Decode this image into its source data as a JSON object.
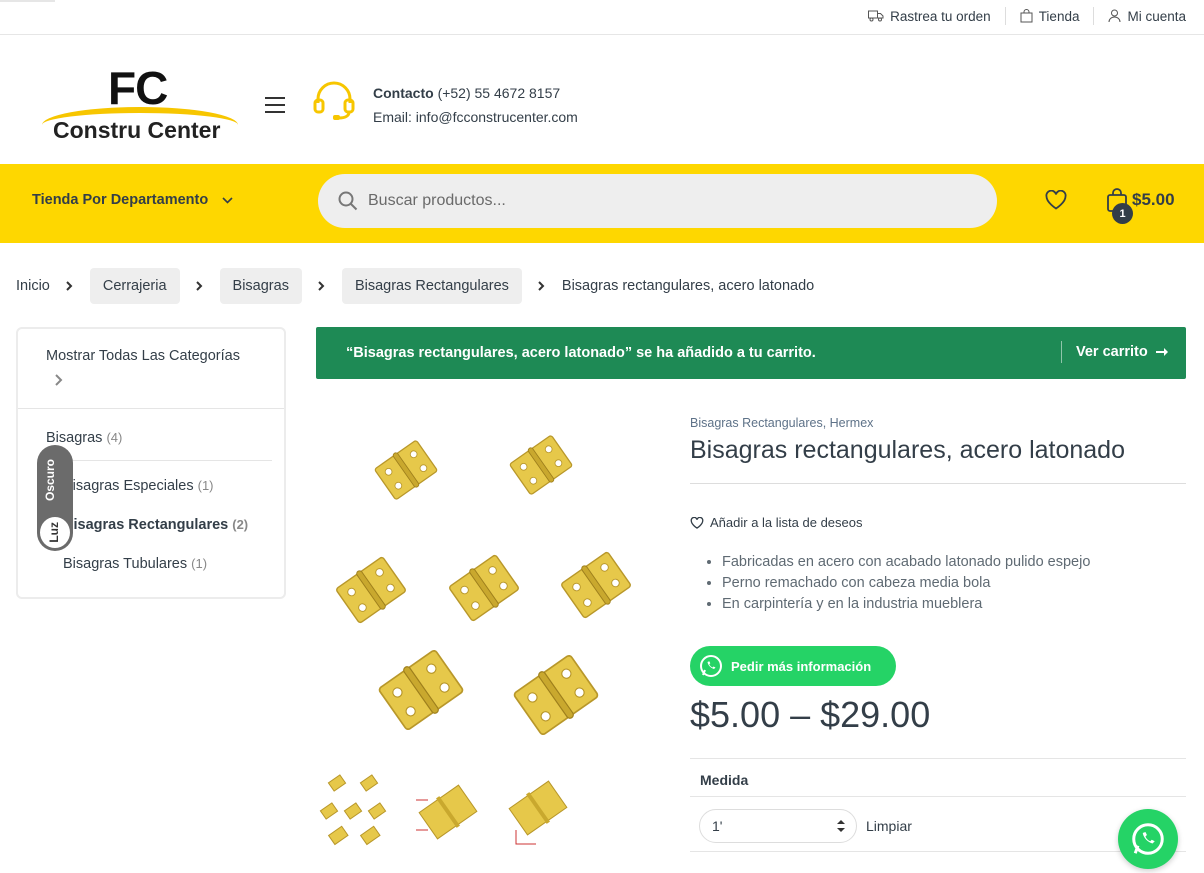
{
  "topbar": {
    "track_order": "Rastrea tu orden",
    "shop": "Tienda",
    "account": "Mi cuenta"
  },
  "logo": {
    "line1": "FC",
    "line2": "Constru Center"
  },
  "contact": {
    "label": "Contacto",
    "phone": "(+52) 55 4672 8157",
    "email": "Email: info@fcconstrucenter.com"
  },
  "nav": {
    "department": "Tienda Por Departamento",
    "search_placeholder": "Buscar productos...",
    "cart_count": "1",
    "cart_total": "$5.00"
  },
  "breadcrumb": [
    "Inicio",
    "Cerrajeria",
    "Bisagras",
    "Bisagras Rectangulares",
    "Bisagras rectangulares, acero latonado"
  ],
  "sidebar": {
    "show_all": "Mostrar Todas Las Categorías",
    "categories": [
      {
        "name": "Bisagras",
        "count": "(4)"
      },
      {
        "name": "Bisagras Especiales",
        "count": "(1)"
      },
      {
        "name": "Bisagras Rectangulares",
        "count": "(2)"
      },
      {
        "name": "Bisagras Tubulares",
        "count": "(1)"
      }
    ]
  },
  "theme_toggle": {
    "dark": "Oscuro",
    "light": "Luz"
  },
  "notice": {
    "message": "“Bisagras rectangulares, acero latonado” se ha añadido a tu carrito.",
    "view_cart": "Ver carrito"
  },
  "product": {
    "categories": "Bisagras Rectangulares, Hermex",
    "title": "Bisagras rectangulares, acero latonado",
    "wishlist": "Añadir a la lista de deseos",
    "features": [
      "Fabricadas en acero con acabado latonado pulido espejo",
      "Perno remachado con cabeza media bola",
      "En carpintería y en la industria mueblera"
    ],
    "info_button": "Pedir más información",
    "price": "$5.00 – $29.00",
    "variation_label": "Medida",
    "variation_value": "1'",
    "clear": "Limpiar"
  },
  "colors": {
    "brand_yellow": "#fed700",
    "notice_green": "#1e8a55",
    "whatsapp": "#25d366",
    "text_dark": "#333e48"
  }
}
